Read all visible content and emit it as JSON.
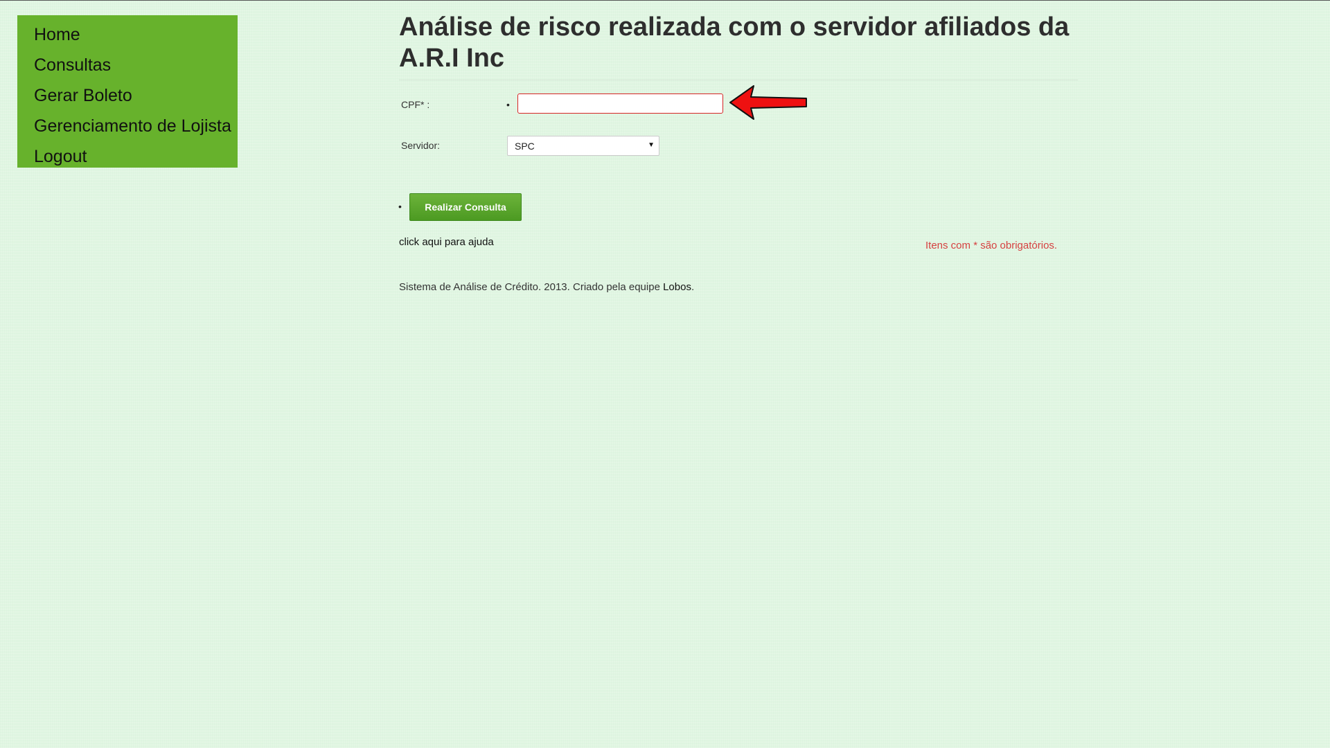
{
  "nav": {
    "items": [
      {
        "label": "Home"
      },
      {
        "label": "Consultas"
      },
      {
        "label": "Gerar Boleto"
      },
      {
        "label": "Gerenciamento de Lojista"
      },
      {
        "label": "Logout"
      }
    ]
  },
  "page": {
    "title": "Análise de risco realizada com o servidor afiliados da A.R.I Inc"
  },
  "form": {
    "cpf_label": "CPF* :",
    "cpf_value": "",
    "server_label": "Servidor:",
    "server_selected": "SPC",
    "bullet": "•",
    "submit_label": "Realizar Consulta"
  },
  "help_link": "click aqui para ajuda",
  "required_note": "Itens com * são obrigatórios.",
  "footer": {
    "text": "Sistema de Análise de Crédito. 2013. Criado pela equipe ",
    "link": "Lobos",
    "suffix": "."
  },
  "annotation": {
    "arrow_color": "#ee1111",
    "icon": "red-arrow-icon"
  }
}
